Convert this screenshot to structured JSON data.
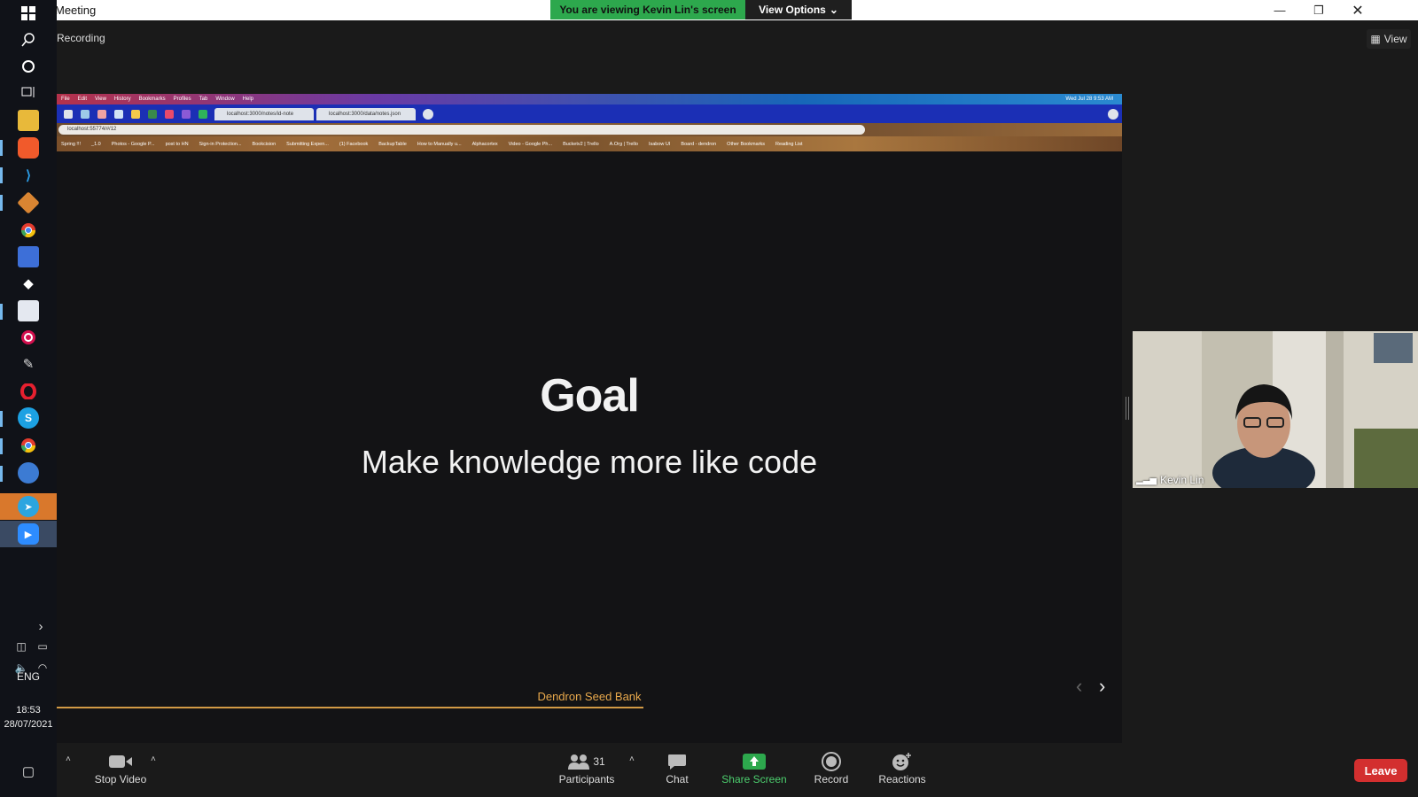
{
  "window": {
    "title": "Meeting"
  },
  "banner": {
    "viewing_text": "You are viewing Kevin Lin's screen",
    "view_options_label": "View Options"
  },
  "meeting": {
    "recording_label": "Recording",
    "view_label": "View"
  },
  "shared_screen": {
    "menubar": [
      "File",
      "Edit",
      "View",
      "History",
      "Bookmarks",
      "Profiles",
      "Tab",
      "Window",
      "Help"
    ],
    "menubar_clock": "Wed Jul 28  9:53 AM",
    "tabs": [
      "localhost:3000/notes/id-note",
      "localhost:3000/data/notes.json"
    ],
    "url": "localhost:55774/#/12",
    "bookmarks": [
      "Spring !!!",
      "_1.0",
      "Photos - Google P...",
      "post to HN",
      "Sign-in Protection...",
      "Bookcision",
      "Submitting Expen...",
      "(1) Facebook",
      "BackupTable",
      "How to Manually u...",
      "Alphacortex",
      "Video - Google Ph...",
      "Bucketv2 | Trello",
      "A.Org | Trello",
      "Isabow UI",
      "Board - dendron",
      "Other Bookmarks",
      "Reading List"
    ],
    "slide": {
      "title": "Goal",
      "subtitle": "Make knowledge more like code",
      "footer": "Dendron Seed Bank"
    }
  },
  "participant": {
    "name": "Kevin Lin"
  },
  "controls": {
    "stop_video": "Stop Video",
    "participants": "Participants",
    "participants_count": "31",
    "chat": "Chat",
    "share_screen": "Share Screen",
    "record": "Record",
    "reactions": "Reactions",
    "leave": "Leave"
  },
  "tray": {
    "language": "ENG",
    "time": "18:53",
    "date": "28/07/2021"
  },
  "colors": {
    "accent_green": "#2da84d",
    "leave_red": "#d32f2f",
    "slide_footer": "#e9a94c"
  }
}
